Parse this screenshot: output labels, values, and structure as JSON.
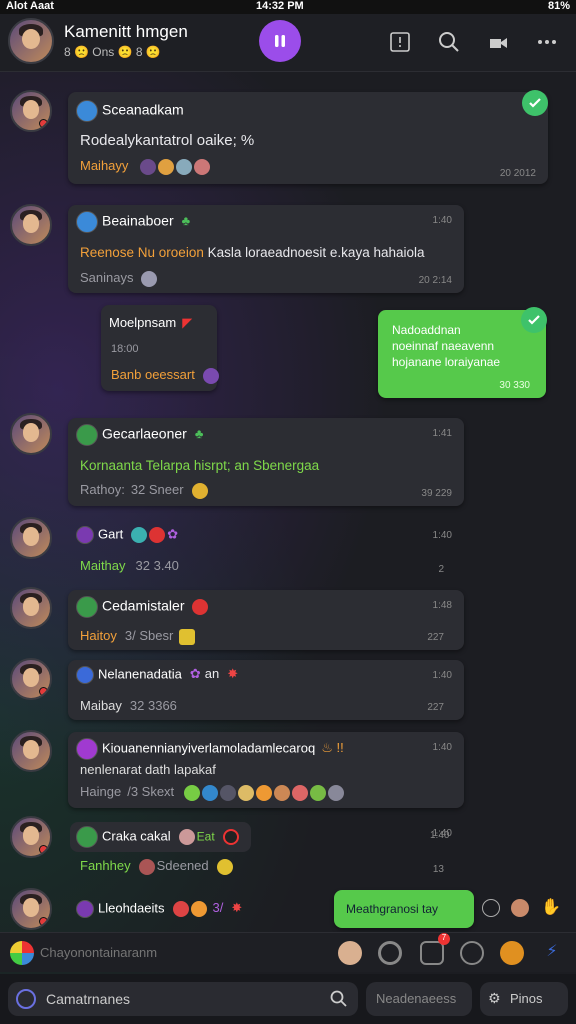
{
  "status": {
    "left": "Alot Aaat",
    "time": "14:32 PM",
    "right": "81%"
  },
  "header": {
    "title": "Kamenitt hmgen",
    "subtitle": "8 🙁 Ons 🙁 8 🙁"
  },
  "icons": {
    "call": "phone-icon",
    "search": "search-icon",
    "video": "video-icon",
    "more": "more-icon"
  },
  "messages": [
    {
      "name": "Sceanadkam",
      "text": "Rodealykantatrol oaike; %",
      "meta_label": "Maihayy",
      "time": "20 2012"
    },
    {
      "name": "Beainaboer",
      "text_orange": "Reenose Nu oroeion",
      "text": " Kasla loraeadnoesit e.kaya hahaiola",
      "meta_label": "Saninays",
      "time_top": "1:40",
      "time": "20 2:14"
    },
    {
      "name": "Moelpnsam",
      "meta_num": "18:00",
      "meta_label": "Banb oeessart"
    },
    {
      "out_text": "Nadoaddnan noeinnaf naeavenn hojanane loraiyanae",
      "time": "30 330"
    },
    {
      "name": "Gecarlaeoner",
      "text": "Kornaanta Telarpa hisrpt; an Sbenergaa",
      "meta_label": "Rathoy:",
      "meta_num": "32 Sneer",
      "time_top": "1:41",
      "time": "39 229"
    },
    {
      "name": "Gart",
      "meta_label": "Maithay",
      "meta_num": "32 3.40",
      "time_top": "1:40",
      "time": "2"
    },
    {
      "name": "Cedamistaler",
      "meta_label": "Haitoy",
      "meta_num": "3/ Sbesr",
      "time_top": "1:48",
      "time": "227"
    },
    {
      "name": "Nelanenadatia",
      "extra": "an",
      "meta_label": "Maibay",
      "meta_num": "32 3366",
      "time_top": "1:40",
      "time": "227"
    },
    {
      "name": "Kiouanennianyiverlamoladamlecaroq",
      "line2": "nenlenarat dath lapakaf",
      "meta_label": "Hainge",
      "meta_num": "/3 Skext",
      "time_top": "1:40"
    },
    {
      "name": "Craka cakal",
      "badge": "Eat",
      "meta_label": "Fanhhey",
      "meta_num": "Sdeened",
      "time_top": "1:40",
      "time": "13"
    },
    {
      "name": "Lleohdaeits",
      "extra": "3/",
      "out_pill": "Meathgranosi tay",
      "time_top": "1:40"
    }
  ],
  "composer": {
    "placeholder": "Chayonontainaranm"
  },
  "bottom": {
    "search_placeholder": "Camatrnanes",
    "pill_mid": "Neadenaeess",
    "pill_right": "Pinos"
  },
  "colors": {
    "accent": "#9b4dea",
    "bubble": "#2c2d33",
    "outgoing": "#56c94b"
  }
}
